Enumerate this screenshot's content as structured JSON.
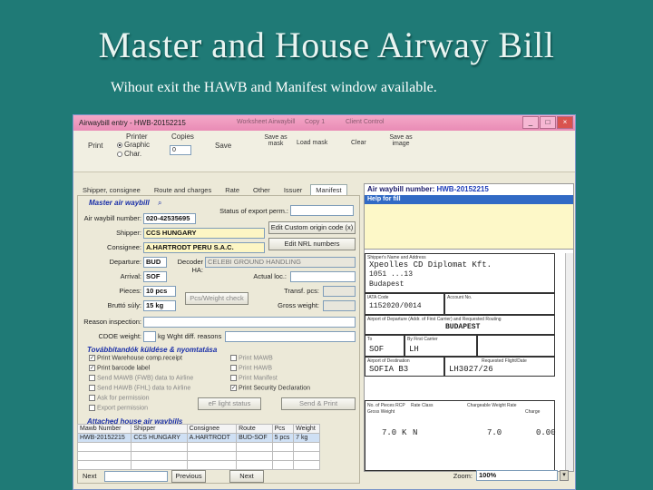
{
  "slide": {
    "title": "Master and House Airway Bill",
    "subtitle": "Wihout exit the HAWB and Manifest window available."
  },
  "window": {
    "title": "Airwaybill entry - HWB-20152215",
    "faint_tabs": [
      "Worksheet Airwaybill",
      "Copy 1",
      "Client Control"
    ]
  },
  "toolbar": {
    "print": "Print",
    "printer_label": "Printer",
    "graphic": "Graphic",
    "char": "Char.",
    "copies_label": "Copies",
    "copies_value": "0",
    "save": "Save",
    "save_as_mask": "Save as mask",
    "load_mask": "Load mask",
    "clear": "Clear",
    "save_as_image": "Save as image"
  },
  "tabs": [
    "Shipper, consignee",
    "Route and charges",
    "Rate",
    "Other",
    "Issuer",
    "Manifest"
  ],
  "master": {
    "section": "Master air waybill",
    "awb_label": "Air waybill number:",
    "awb_value": "020-42535695",
    "status_label": "Status of export perm.:",
    "shipper_label": "Shipper:",
    "shipper_value": "CCS HUNGARY",
    "edit_custom": "Edit Custom origin code (x)",
    "consignee_label": "Consignee:",
    "consignee_value": "A.HARTRODT PERU S.A.C.",
    "edit_nrl": "Edit NRL numbers",
    "departure_label": "Departure:",
    "departure_value": "BUD",
    "decoder_label": "Decoder HA:",
    "decoder_value": "CELEBI GROUND HANDLING",
    "arrival_label": "Arrival:",
    "arrival_value": "SOF",
    "actual_loc_label": "Actual loc.:",
    "pieces_label": "Pieces:",
    "pieces_value": "10 pcs",
    "transf_label": "Transf. pcs:",
    "gross_label": "Bruttó súly:",
    "gross_value": "15 kg",
    "pcs_weight_check": "Pcs/Weight check",
    "gross_weight_label": "Gross weight:",
    "reason_label": "Reason inspection:",
    "cdoe_label": "CDOE weight:",
    "kg_diff": "kg Wght diff. reasons"
  },
  "options": {
    "section": "Továbbítandók küldése & nyomtatása",
    "left": [
      {
        "label": "Print Warehouse comp.receipt",
        "checked": true
      },
      {
        "label": "Print barcode label",
        "checked": true
      },
      {
        "label": "Send MAWB (FWB) data to Airline",
        "checked": false
      },
      {
        "label": "Send HAWB (FHL) data to Airline",
        "checked": false
      },
      {
        "label": "Ask for permission",
        "checked": false
      },
      {
        "label": "Export permission",
        "checked": false
      }
    ],
    "right": [
      {
        "label": "Print MAWB",
        "checked": false
      },
      {
        "label": "Print HAWB",
        "checked": false
      },
      {
        "label": "Print Manifest",
        "checked": false
      },
      {
        "label": "Print Security Declaration",
        "checked": true
      }
    ],
    "flight_status": "eF light status",
    "send_print": "Send & Print"
  },
  "house": {
    "section": "Attached house air waybills",
    "columns": [
      "Mawb Number",
      "Shipper",
      "Consignee",
      "Route",
      "Pcs",
      "Weight"
    ],
    "rows": [
      [
        "HWB-20152215",
        "CCS HUNGARY",
        "A.HARTRODT",
        "BUD-SOF",
        "5 pcs",
        "7 kg"
      ]
    ]
  },
  "bottom": {
    "next_label": "Next",
    "previous": "Previous",
    "next": "Next",
    "zoom_label": "Zoom:",
    "zoom_value": "100%"
  },
  "awb_panel": {
    "header_label": "Air waybill number:",
    "header_value": "HWB-20152215",
    "help": "Help for fill",
    "shipper_cap": "Shipper's Name and Address",
    "shipper_line1": "Xpeolles CD Diplomat Kft.",
    "shipper_line2": "1051 ...13",
    "shipper_line3": "Budapest",
    "cap_issuer_code": "IATA Code",
    "issuer_code": "1152020/0014",
    "cap_account": "Account No.",
    "cap_departure": "Airport of Departure (Addr. of First Carrier) and Requested Routing",
    "departure": "BUDAPEST",
    "cap_to": "To",
    "cap_by": "By First Carrier",
    "to": "SOF",
    "by": "LH",
    "cap_destination": "Airport of Destination",
    "destination": "SOFIA B3",
    "cap_flight": "Requested Flight/Date",
    "flight": "LH3027/26",
    "cap_pieces": "No. of Pieces RCP",
    "cap_gross": "Gross Weight",
    "cap_rate_class": "Rate Class",
    "cap_chargeable": "Chargeable Weight",
    "cap_rate": "Rate",
    "cap_charge": "Charge",
    "gross_weight": "7.0",
    "unit": "K",
    "rate_class": "N",
    "chargeable": "7.0",
    "charge": "0.00"
  },
  "colors": {
    "slide_bg": "#1f7a76",
    "titlebar": "#e98bb5",
    "link_blue": "#1a3ab8",
    "help_bar": "#316ac5",
    "help_body": "#fdf8c8"
  }
}
